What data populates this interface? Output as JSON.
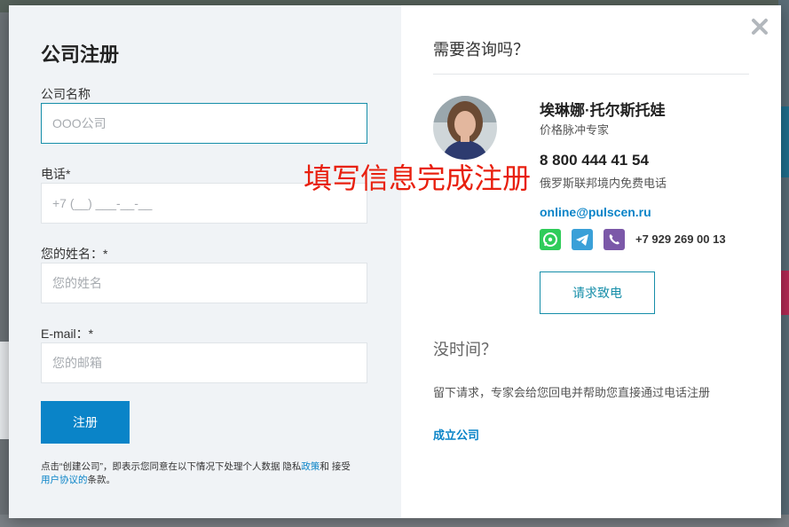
{
  "modal": {
    "close_icon": "close-icon"
  },
  "form": {
    "title": "公司注册",
    "company_label": "公司名称",
    "company_value": "",
    "company_placeholder": "OOO公司",
    "phone_label": "电话*",
    "phone_value": "",
    "phone_placeholder": "+7 (__) ___-__-__",
    "name_label": "您的姓名：*",
    "name_value": "",
    "name_placeholder": "您的姓名",
    "email_label": "E-mail：*",
    "email_value": "",
    "email_placeholder": "您的邮箱",
    "submit_label": "注册",
    "legal_prefix": "点击“创建公司”，即表示您同意在以下情况下处理个人数据 隐私",
    "legal_policy_link": "政策",
    "legal_middle": "和 接受",
    "legal_terms_link": "用户协议的",
    "legal_suffix": "条款。"
  },
  "consult": {
    "heading": "需要咨询吗？",
    "expert_name": "埃琳娜·托尔斯托娃",
    "expert_role": "价格脉冲专家",
    "phone": "8 800 444 41 54",
    "phone_note": "俄罗斯联邦境内免费电话",
    "email": "online@pulscen.ru",
    "messengers": [
      "whatsapp-icon",
      "telegram-icon",
      "viber-icon"
    ],
    "messenger_phone": "+7 929 269 00 13",
    "callback_label": "请求致电",
    "no_time_heading": "没时间？",
    "no_time_text": "留下请求，专家会给您回电并帮助您直接通过电话注册",
    "create_company_link": "成立公司"
  },
  "overlay": {
    "caption": "填写信息完成注册"
  },
  "colors": {
    "accent": "#0a84c8",
    "focus": "#168ea9",
    "overlay_text": "#e8200f"
  }
}
